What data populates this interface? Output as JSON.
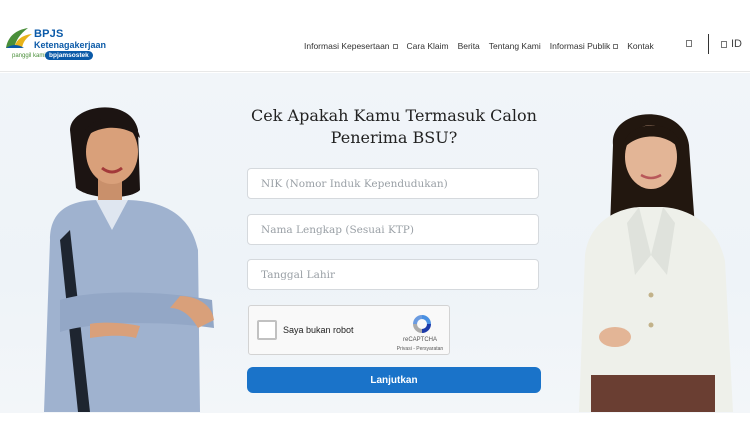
{
  "header": {
    "logo": {
      "brand": "BPJS",
      "sub": "Ketenagakerjaan",
      "tagline": "panggil kami",
      "pill": "bpjamsostek",
      "colors": {
        "blue": "#0b5aa8",
        "green": "#4a8f3a",
        "yellow": "#e8b31a"
      }
    },
    "nav": [
      {
        "label": "Informasi Kepesertaan",
        "has_dropdown": true
      },
      {
        "label": "Cara Klaim",
        "has_dropdown": false
      },
      {
        "label": "Berita",
        "has_dropdown": false
      },
      {
        "label": "Tentang Kami",
        "has_dropdown": false
      },
      {
        "label": "Informasi Publik",
        "has_dropdown": true
      },
      {
        "label": "Kontak",
        "has_dropdown": false
      }
    ],
    "search_icon": "search-icon",
    "language": {
      "icon": "globe-icon",
      "label": "ID"
    }
  },
  "form": {
    "title": "Cek Apakah Kamu Termasuk Calon Penerima BSU?",
    "fields": {
      "nik": {
        "placeholder": "NIK (Nomor Induk Kependudukan)",
        "value": ""
      },
      "name": {
        "placeholder": "Nama Lengkap (Sesuai KTP)",
        "value": ""
      },
      "dob": {
        "placeholder": "Tanggal Lahir",
        "value": ""
      }
    },
    "captcha": {
      "label": "Saya bukan robot",
      "checked": false,
      "brand": "reCAPTCHA",
      "links": "Privasi - Persyaratan"
    },
    "submit_label": "Lanjutkan",
    "accent_color": "#1a73c9"
  }
}
